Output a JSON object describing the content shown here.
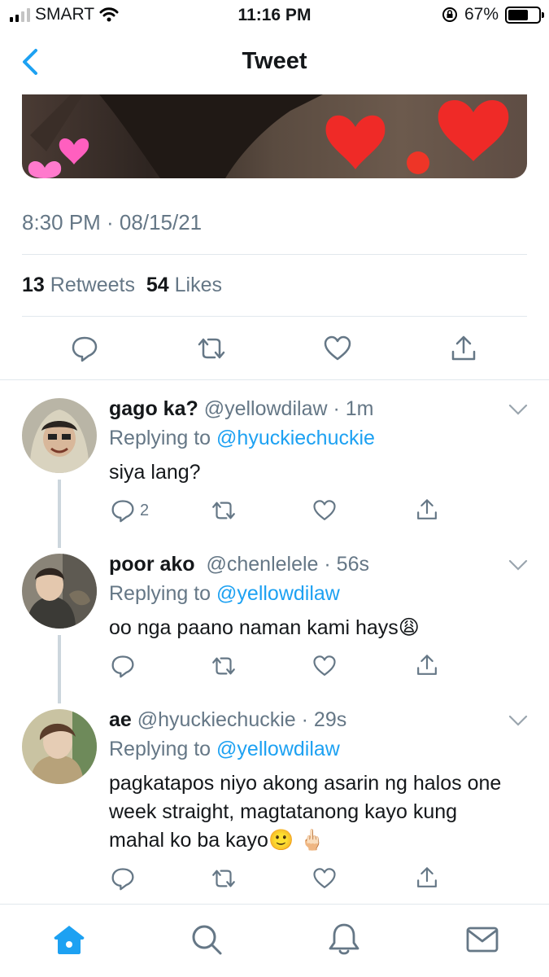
{
  "status_bar": {
    "carrier": "SMART",
    "time": "11:16 PM",
    "battery": "67%",
    "battery_level": 0.67,
    "signal_bars": 2
  },
  "nav": {
    "title": "Tweet",
    "back_icon": "chevron-left-icon"
  },
  "tweet": {
    "timestamp": "8:30 PM · 08/15/21",
    "retweets_count": "13",
    "retweets_label": "Retweets",
    "likes_count": "54",
    "likes_label": "Likes"
  },
  "replies": [
    {
      "name": "gago ka?",
      "handle": "@yellowdilaw",
      "time": "· 1m",
      "replying_prefix": "Replying to",
      "replying_to": "@hyuckiechuckie",
      "text": "siya lang?",
      "reply_count": "2"
    },
    {
      "name": "poor ako",
      "handle": "@chenlelele",
      "time": "· 56s",
      "replying_prefix": "Replying to",
      "replying_to": "@yellowdilaw",
      "text": "oo nga paano naman kami hays😩",
      "reply_count": ""
    },
    {
      "name": "ae",
      "handle": "@hyuckiechuckie",
      "time": "· 29s",
      "replying_prefix": "Replying to",
      "replying_to": "@yellowdilaw",
      "text": "pagkatapos niyo akong asarin ng halos one week straight, magtatanong kayo kung mahal ko ba kayo🙂 🖕🏻",
      "reply_count": ""
    }
  ],
  "colors": {
    "accent": "#1da1f2",
    "secondary_text": "#657786",
    "divider": "#e1e8ed"
  }
}
